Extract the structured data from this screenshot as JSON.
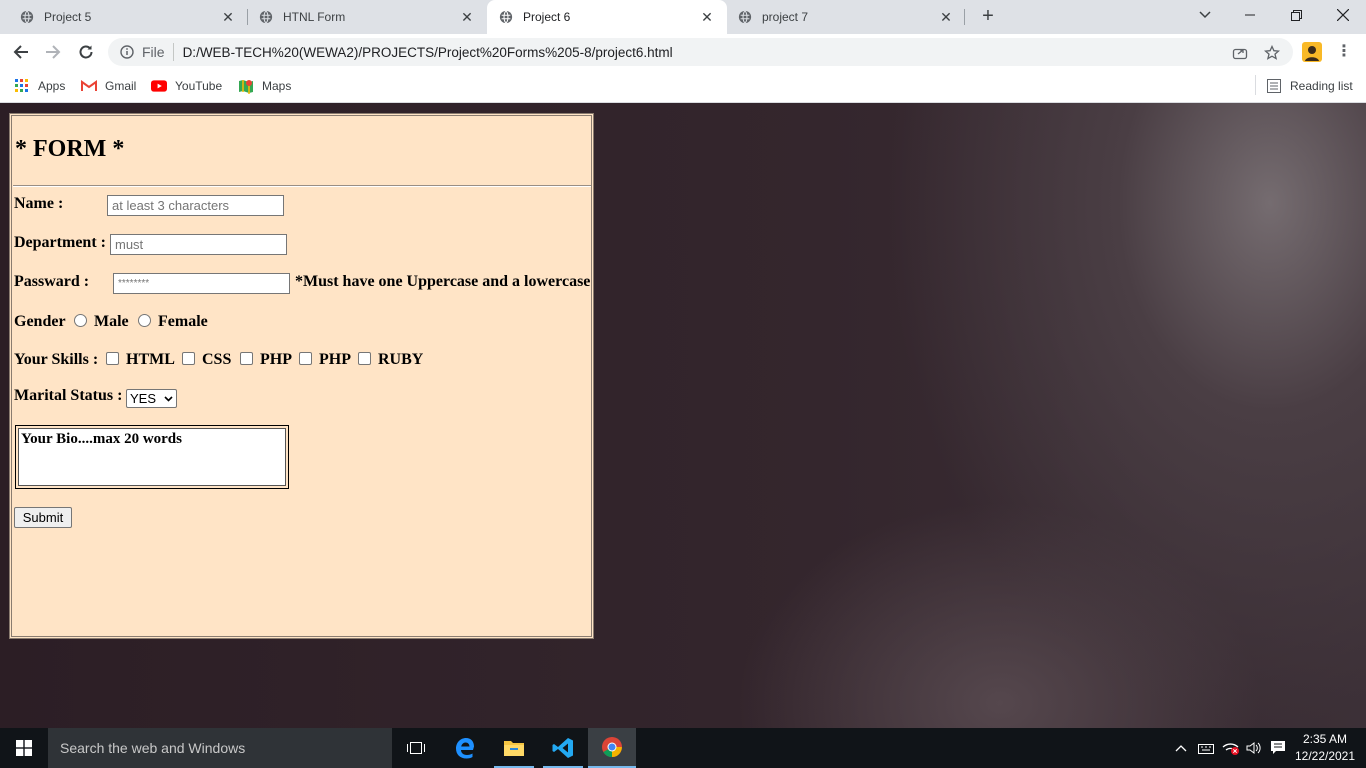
{
  "browser": {
    "tabs": [
      {
        "title": "Project 5",
        "active": false
      },
      {
        "title": "HTNL Form",
        "active": false
      },
      {
        "title": "Project 6",
        "active": true
      },
      {
        "title": "project 7",
        "active": false
      }
    ],
    "new_tab_label": "+",
    "address": {
      "scheme_label": "File",
      "url": "D:/WEB-TECH%20(WEWA2)/PROJECTS/Project%20Forms%205-8/project6.html"
    },
    "bookmarks": [
      {
        "label": "Apps",
        "icon": "apps-grid-icon"
      },
      {
        "label": "Gmail",
        "icon": "gmail-icon"
      },
      {
        "label": "YouTube",
        "icon": "youtube-icon"
      },
      {
        "label": "Maps",
        "icon": "maps-icon"
      }
    ],
    "reading_list_label": "Reading list"
  },
  "form": {
    "title": "* FORM *",
    "name_label": "Name :",
    "name_placeholder": "at least 3 characters",
    "department_label": "Department :",
    "department_placeholder": "must",
    "password_label": "Passward :",
    "password_placeholder": "********",
    "password_hint": "*Must have one Uppercase and a lowercase",
    "gender_label": "Gender",
    "gender_options": [
      "Male",
      "Female"
    ],
    "skills_label": "Your Skills :",
    "skills": [
      "HTML",
      "CSS",
      "PHP",
      "PHP",
      "RUBY"
    ],
    "marital_label": "Marital Status :",
    "marital_selected": "YES",
    "bio_text": "Your Bio....max 20 words",
    "submit_label": "Submit",
    "background_color": "#ffe4c6"
  },
  "taskbar": {
    "search_placeholder": "Search the web and Windows",
    "time": "2:35 AM",
    "date": "12/22/2021"
  }
}
